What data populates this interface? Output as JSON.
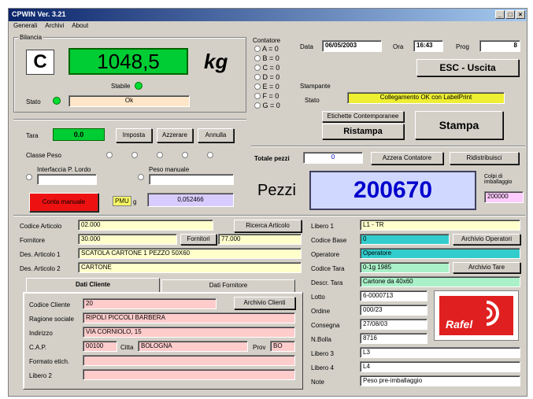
{
  "window": {
    "title": "CPWIN Ver. 3.21"
  },
  "menu": [
    "Generali",
    "Archivi",
    "About"
  ],
  "weight": {
    "group_label": "Bilancia",
    "scale_letter": "C",
    "value": "1048,5",
    "unit": "kg",
    "stable_label": "Stabile",
    "state_label": "Stato",
    "state_value": "Ok"
  },
  "tare": {
    "label": "Tara",
    "value": "0.0",
    "buttons": [
      "Imposta",
      "Azzerare",
      "Annulla"
    ]
  },
  "weigh_class": {
    "label": "Classe Peso"
  },
  "qty": {
    "gross_label": "Interfaccia P. Lordo",
    "manual_label": "Peso manuale",
    "red_button": "Conta manuale",
    "unit_weight_label": "PMU",
    "unit_weight_value": "0,052466",
    "unit_weight_tag": "g"
  },
  "contatore": {
    "label": "Contatore",
    "items": [
      "A = 0",
      "B = 0",
      "C = 0",
      "D = 0",
      "E = 0",
      "F = 0",
      "G = 0"
    ]
  },
  "header": {
    "date_label": "Data",
    "date_value": "06/05/2003",
    "time_label": "Ora",
    "time_value": "16:43",
    "prog_label": "Prog",
    "prog_value": "8",
    "exit_button": "ESC - Uscita"
  },
  "print": {
    "group_label": "Stampante",
    "status_label": "Stato",
    "status_value": "Collegamento OK con LabelPrint",
    "labels_button": "Etichette Contemporanee",
    "reprint_button": "Ristampa",
    "print_button": "Stampa"
  },
  "totals": {
    "label": "Totale pezzi",
    "value": "0",
    "reset_button": "Azzera Contatore",
    "count_button": "Ridistribuisci"
  },
  "pieces": {
    "label": "Pezzi",
    "value": "200670",
    "packs_label": "Colpi di imballaggio",
    "packs_value": "200000"
  },
  "articolo": {
    "rows": [
      {
        "label": "Codice Articolo",
        "value": "02.000"
      },
      {
        "label": "Fornitore",
        "value": "30.000",
        "button": "Fornitori",
        "extra": "77.000"
      },
      {
        "label": "Des. Articolo 1",
        "value": "SCATOLA CARTONE 1 PEZZO 50X60"
      },
      {
        "label": "Des. Articolo 2",
        "value": "CARTONE"
      }
    ],
    "search_button": "Ricerca Articolo"
  },
  "tabs": [
    "Dati Cliente",
    "Dati Fornitore"
  ],
  "cliente": {
    "rows": [
      {
        "label": "Codice Cliente",
        "value": "20",
        "button": "Archivio Clienti"
      },
      {
        "label": "Ragione sociale",
        "value": "RIPOLI PICCOLI BARBERA"
      },
      {
        "label": "Indirizzo",
        "value": "VIA CORNIOLO, 15"
      },
      {
        "label": "C.A.P.",
        "value": "00100",
        "city_label": "Citta",
        "city_value": "BOLOGNA",
        "prov_label": "Prov",
        "prov_value": "BO"
      },
      {
        "label": "Formato etich.",
        "value": ""
      },
      {
        "label": "Libero 2",
        "value": ""
      }
    ]
  },
  "right_panel": {
    "rows": [
      {
        "label": "Libero 1",
        "value": "L1 - TR"
      },
      {
        "label": "Codice Base",
        "value": "0",
        "button": "Archivio Operatori"
      },
      {
        "label": "Operatore",
        "value": "Operatore"
      },
      {
        "label": "Codice Tara",
        "value": "0-1g 1985",
        "button": "Archivio Tare"
      },
      {
        "label": "Descr. Tara",
        "value": "Cartone da 40x60"
      },
      {
        "label": "Lotto",
        "value": "6-0000713"
      },
      {
        "label": "Ordine",
        "value": "000/23"
      },
      {
        "label": "Consegna",
        "value": "27/08/03"
      },
      {
        "label": "N.Bolla",
        "value": "8716"
      },
      {
        "label": "Libero 3",
        "value": "L3"
      },
      {
        "label": "Libero 4",
        "value": "L4"
      },
      {
        "label": "Note",
        "value": "Peso pre-imballaggio"
      }
    ],
    "logo_text": "Rafel"
  },
  "colors": {
    "weight_bg": "#00cc33",
    "pieces_bg": "#d0d8ff",
    "pieces_fg": "#0000cc",
    "red_button": "#ee1111",
    "status_yellow": "#eeee33"
  }
}
